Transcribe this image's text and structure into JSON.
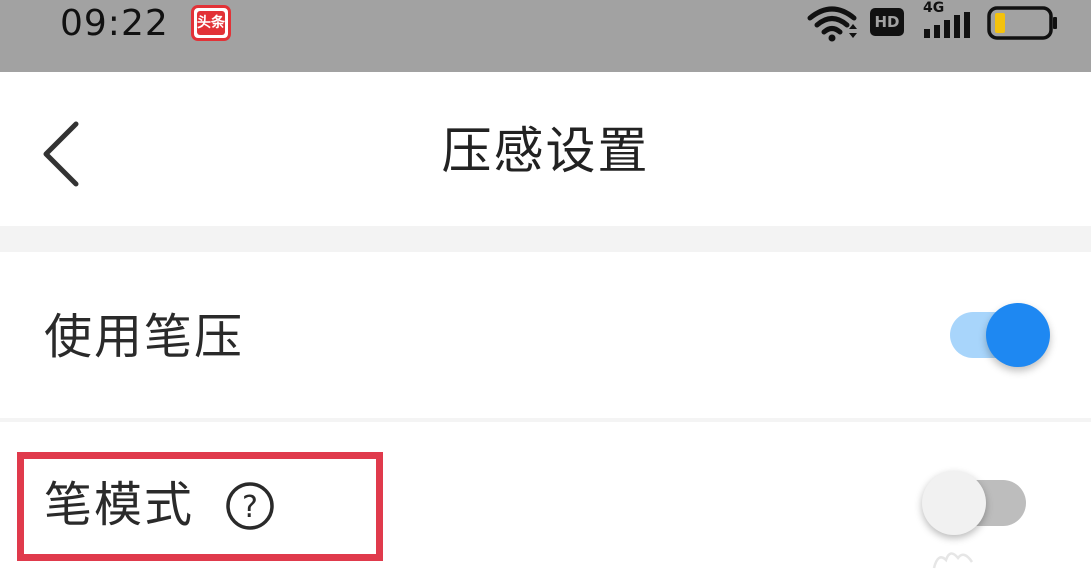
{
  "status_bar": {
    "time": "09:22",
    "app_badge": "头条",
    "wifi_icon": "wifi-icon",
    "hd_label": "HD",
    "network_label": "4G",
    "signal_icon": "signal-icon",
    "battery_icon": "battery-low-icon"
  },
  "header": {
    "back_icon": "chevron-left-icon",
    "title": "压感设置"
  },
  "settings": [
    {
      "label": "使用笔压",
      "toggle_on": true,
      "toggle_color": "#1e88f2"
    },
    {
      "label": "笔模式",
      "help_icon": "question-circle-icon",
      "help_glyph": "?",
      "toggle_on": false,
      "highlighted": true,
      "highlight_color": "#e03a4c"
    }
  ],
  "colors": {
    "status_bar_bg": "#a2a2a2",
    "accent": "#1e88f2",
    "battery_level": "#f4c20d"
  }
}
